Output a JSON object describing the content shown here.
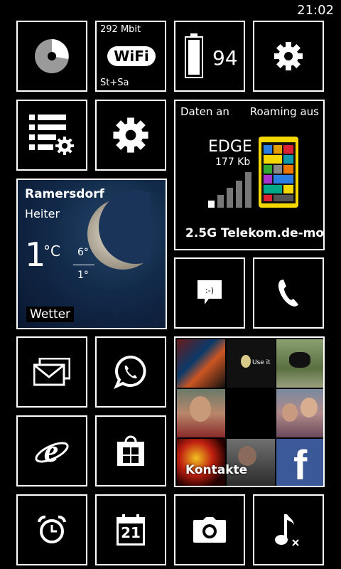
{
  "status": {
    "time": "21:02"
  },
  "tiles": {
    "data_usage": {
      "name": "data usage"
    },
    "wifi": {
      "speed": "292 Mbit",
      "badge": "WiFi",
      "network": "St+Sa"
    },
    "battery": {
      "percent": "94"
    },
    "settings": {
      "name": "settings"
    },
    "settings_list": {
      "name": "settings list"
    },
    "settings2": {
      "name": "settings"
    },
    "network": {
      "data": "Daten an",
      "roaming": "Roaming aus",
      "tech": "EDGE",
      "speed": "177 Kb",
      "operator": "2.5G Telekom.de-mo"
    },
    "weather": {
      "city": "Ramersdorf",
      "condition": "Heiter",
      "temp": "1",
      "unit": "°C",
      "high": "6°",
      "low": "1°",
      "app": "Wetter"
    },
    "messaging": {
      "name": "messaging"
    },
    "phone": {
      "name": "phone"
    },
    "mail": {
      "name": "mail"
    },
    "whatsapp": {
      "name": "whatsapp"
    },
    "contacts": {
      "label": "Kontakte",
      "photo_text": "Use it"
    },
    "ie": {
      "name": "internet explorer"
    },
    "store": {
      "name": "store"
    },
    "alarm": {
      "name": "alarm"
    },
    "calendar": {
      "day": "21"
    },
    "camera": {
      "name": "camera"
    },
    "music": {
      "name": "music"
    }
  },
  "colors": {
    "background": "#000000",
    "tile_border": "#ffffff",
    "lumia_yellow": "#f5d800",
    "facebook": "#3b5998"
  }
}
